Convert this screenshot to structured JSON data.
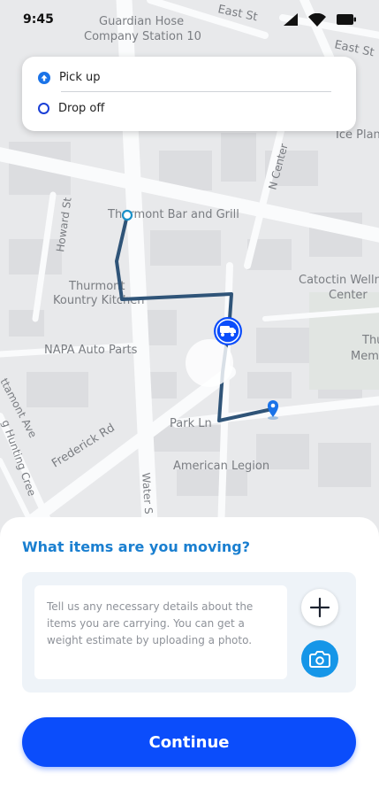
{
  "status_bar": {
    "time": "9:45"
  },
  "map": {
    "labels": {
      "guardian_1": "Guardian Hose",
      "guardian_2": "Company Station 10",
      "east_st_1": "East St",
      "east_st_2": "East St",
      "ice_plant": "Ice Plan",
      "n_center": "N Center",
      "howard": "Howard St",
      "thurmont_bar": "Thurmont Bar and Grill",
      "catoctin_1": "Catoctin Welln",
      "catoctin_2": "Center",
      "thurmont_k1": "Thurmont",
      "thurmont_k2": "Kountry Kitchen",
      "napa": "NAPA Auto Parts",
      "thu": "Thu",
      "mem": "Mem",
      "ttamont": "ttamont Ave",
      "frederick": "Frederick Rd",
      "park_ln": "Park Ln",
      "american_legion": "American Legion",
      "water": "Water S",
      "hunting": "g Hunting Cree"
    }
  },
  "route_card": {
    "pickup_label": "Pick up",
    "dropoff_label": "Drop off"
  },
  "items_sheet": {
    "title": "What items are you moving?",
    "details_placeholder": "Tell us any necessary details about the items you are carrying. You can get a weight estimate by uploading a photo."
  },
  "continue_label": "Continue",
  "icons": {
    "pickup": "arrow-up-circle-icon",
    "dropoff": "ring-icon",
    "add": "plus-icon",
    "photo": "camera-icon",
    "vehicle": "truck-icon",
    "destination": "location-pin-icon"
  },
  "colors": {
    "accent_blue": "#0b4dfb",
    "title_blue": "#1a7fd0",
    "route_line": "#2f5478",
    "camera_blue": "#1696e8"
  }
}
